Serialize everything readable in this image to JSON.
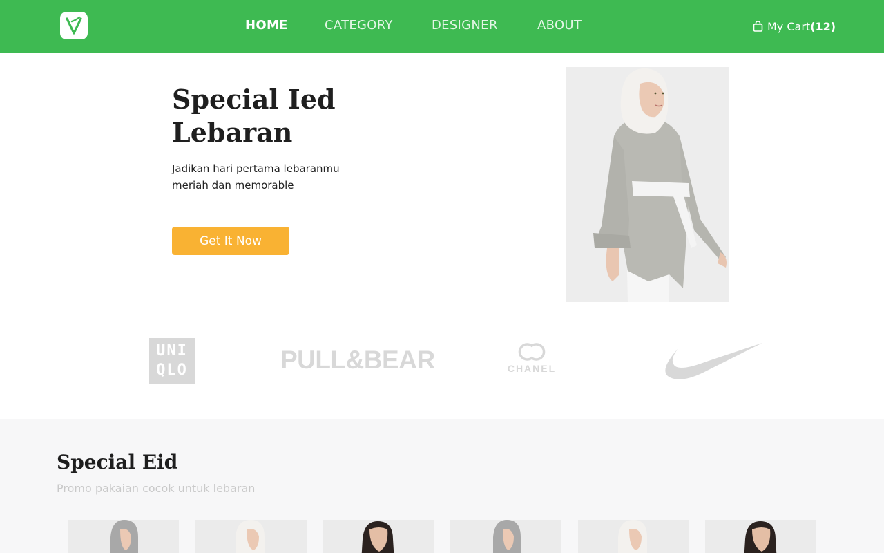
{
  "brand_logo": {
    "letter": "V",
    "icon": "v-logo-icon",
    "color": "#3eba52"
  },
  "nav": {
    "items": [
      {
        "label": "HOME",
        "active": true
      },
      {
        "label": "CATEGORY",
        "active": false
      },
      {
        "label": "DESIGNER",
        "active": false
      },
      {
        "label": "ABOUT",
        "active": false
      }
    ],
    "background": "#3eba52"
  },
  "cart": {
    "icon": "shopping-bag-icon",
    "label": "My Cart",
    "count_display": "(12)"
  },
  "hero": {
    "title": "Special Ied Lebaran",
    "subtitle": "Jadikan hari pertama lebaranmu meriah dan memorable",
    "cta_label": "Get It Now",
    "cta_color": "#f9b233"
  },
  "brands": {
    "uniqlo_line1": "UNI",
    "uniqlo_line2": "QLO",
    "pullbear": "PULL&BEAR",
    "chanel": "CHANEL",
    "nike_icon": "nike-swoosh-icon"
  },
  "special_eid": {
    "title": "Special Eid",
    "subtitle": "Promo pakaian cocok untuk lebaran"
  }
}
